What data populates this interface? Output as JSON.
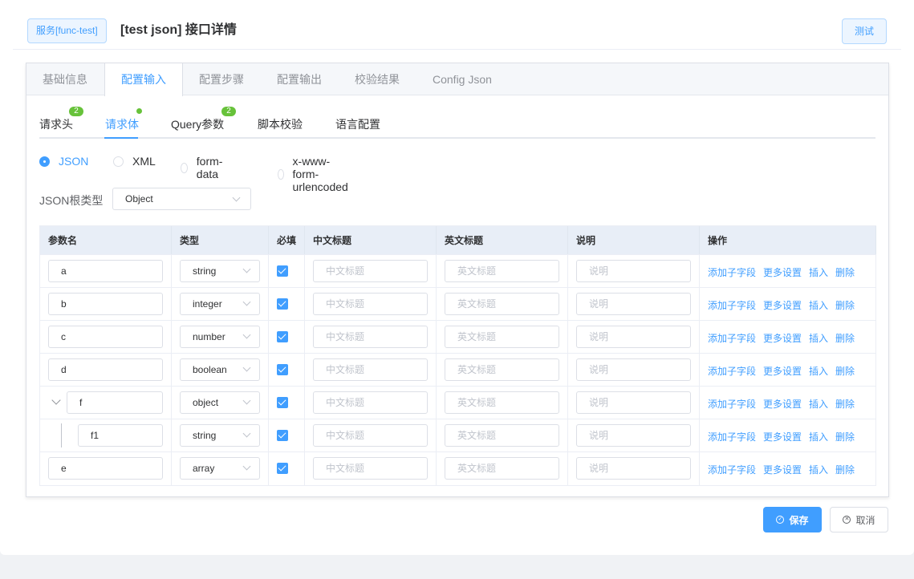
{
  "header": {
    "service_tag": "服务[func-test]",
    "title": "[test json] 接口详情",
    "test_label": "测试"
  },
  "tabs": [
    {
      "label": "基础信息",
      "active": false
    },
    {
      "label": "配置输入",
      "active": true
    },
    {
      "label": "配置步骤",
      "active": false
    },
    {
      "label": "配置输出",
      "active": false
    },
    {
      "label": "校验结果",
      "active": false
    },
    {
      "label": "Config Json",
      "active": false
    }
  ],
  "subtabs": {
    "headers": {
      "label": "请求头",
      "badge": "2"
    },
    "body": {
      "label": "请求体"
    },
    "query": {
      "label": "Query参数",
      "badge": "2"
    },
    "script": {
      "label": "脚本校验"
    },
    "lang": {
      "label": "语言配置"
    }
  },
  "body_types": {
    "selected": "JSON",
    "options": [
      "JSON",
      "XML",
      "form-data",
      "x-www-form-urlencoded"
    ]
  },
  "root_type": {
    "label": "JSON根类型",
    "value": "Object"
  },
  "table": {
    "headers": {
      "name": "参数名",
      "type": "类型",
      "required": "必填",
      "zh_title": "中文标题",
      "en_title": "英文标题",
      "desc": "说明",
      "ops": "操作"
    },
    "placeholders": {
      "zh_title": "中文标题",
      "en_title": "英文标题",
      "desc": "说明"
    },
    "ops": {
      "add_child": "添加子字段",
      "more": "更多设置",
      "insert": "插入",
      "delete": "删除"
    },
    "rows": [
      {
        "name": "a",
        "type": "string",
        "required": true
      },
      {
        "name": "b",
        "type": "integer",
        "required": true
      },
      {
        "name": "c",
        "type": "number",
        "required": true
      },
      {
        "name": "d",
        "type": "boolean",
        "required": true
      },
      {
        "name": "f",
        "type": "object",
        "required": true
      },
      {
        "name": "f1",
        "type": "string",
        "required": true
      },
      {
        "name": "e",
        "type": "array",
        "required": true
      }
    ]
  },
  "footer": {
    "save_label": "保存",
    "cancel_label": "取消"
  },
  "colors": {
    "primary": "#409eff",
    "success": "#67c23a"
  }
}
